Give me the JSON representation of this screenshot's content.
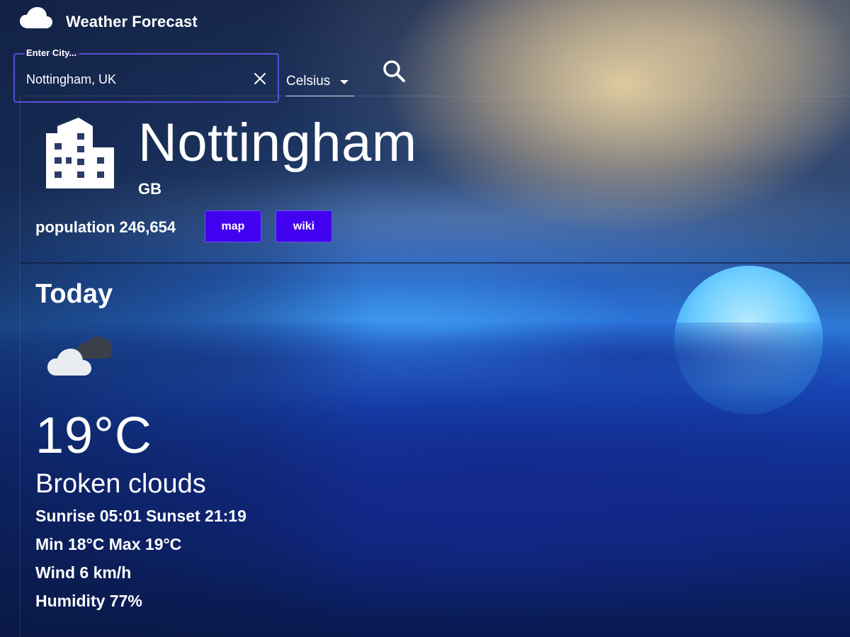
{
  "app": {
    "title": "Weather Forecast",
    "logo_icon": "cloud-icon"
  },
  "search": {
    "label": "Enter City...",
    "value": "Nottingham, UK",
    "clear_icon": "close-icon",
    "unit": "Celsius",
    "search_icon": "search-icon"
  },
  "city": {
    "icon": "building-icon",
    "name": "Nottingham",
    "country": "GB",
    "population": "population 246,654",
    "map_label": "map",
    "wiki_label": "wiki"
  },
  "today": {
    "title": "Today",
    "icon": "broken-clouds-icon",
    "temperature": "19°C",
    "description": "Broken clouds",
    "sun": "Sunrise 05:01 Sunset 21:19",
    "minmax": "Min 18°C Max 19°C",
    "wind": "Wind 6 km/h",
    "humidity": "Humidity 77%"
  },
  "colors": {
    "accent": "#4200f0",
    "field_border": "#5b4fd6"
  }
}
